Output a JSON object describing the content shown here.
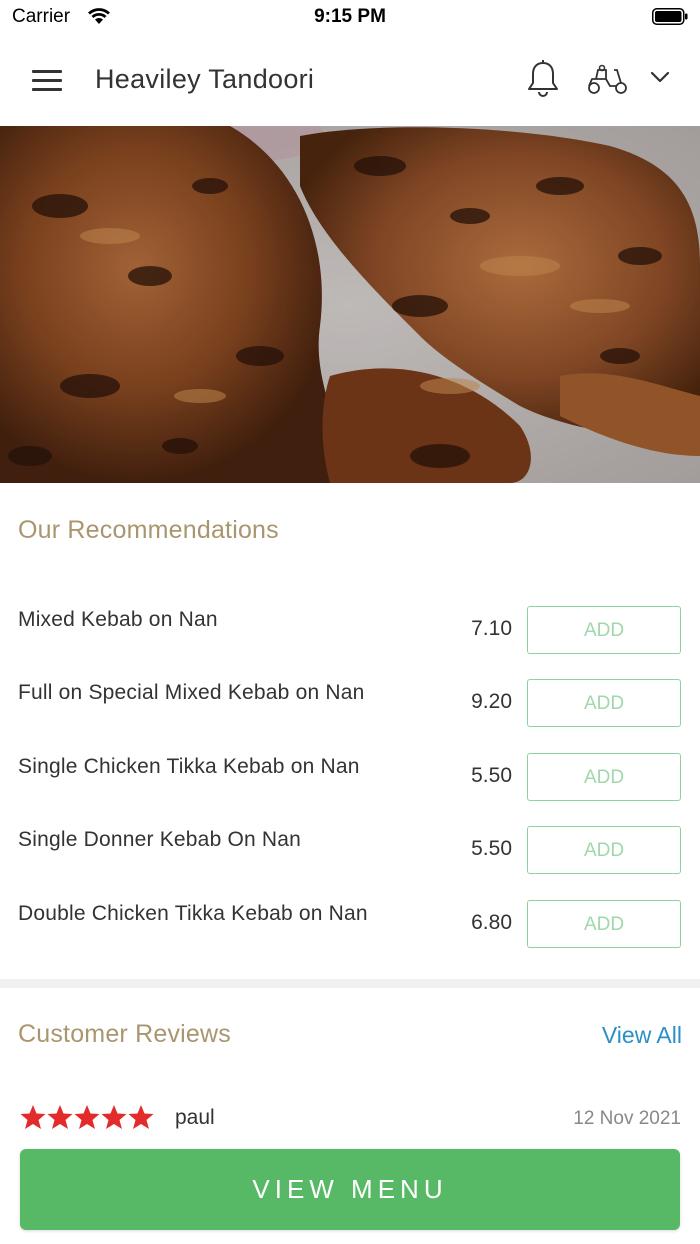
{
  "status_bar": {
    "carrier": "Carrier",
    "time": "9:15 PM"
  },
  "header": {
    "title": "Heaviley Tandoori",
    "icons": [
      "menu-icon",
      "bell-icon",
      "scooter-icon",
      "chevron-down-icon"
    ]
  },
  "recommendations": {
    "title": "Our Recommendations",
    "items": [
      {
        "name": "Mixed Kebab on Nan",
        "price": "7.10",
        "action": "ADD"
      },
      {
        "name": "Full on Special Mixed Kebab on Nan",
        "price": "9.20",
        "action": "ADD"
      },
      {
        "name": "Single Chicken Tikka Kebab on Nan",
        "price": "5.50",
        "action": "ADD"
      },
      {
        "name": "Single Donner Kebab On Nan",
        "price": "5.50",
        "action": "ADD"
      },
      {
        "name": "Double Chicken Tikka Kebab on Nan",
        "price": "6.80",
        "action": "ADD"
      }
    ]
  },
  "reviews": {
    "title": "Customer Reviews",
    "view_all": "View All",
    "items": [
      {
        "rating": 5,
        "author": "paul",
        "date": "12 Nov 2021"
      }
    ]
  },
  "cta": {
    "label": "VIEW MENU"
  },
  "colors": {
    "accent_gold": "#a9966f",
    "button_green": "#57b866",
    "add_border": "#8fd19e",
    "link_blue": "#2a8fc6",
    "star_red": "#e32b2b"
  }
}
